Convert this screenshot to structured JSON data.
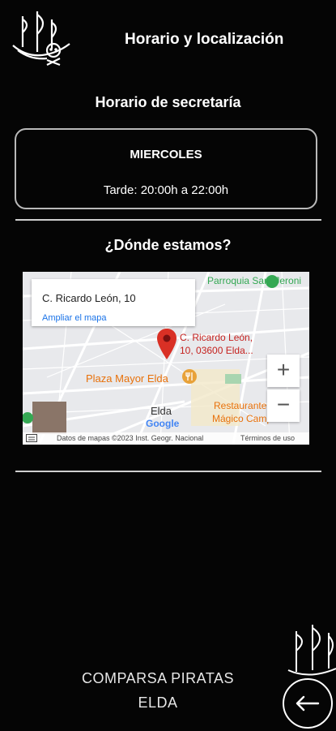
{
  "header": {
    "title": "Horario y localización",
    "logo_icon": "pirate-ship-skull-logo"
  },
  "schedule": {
    "title": "Horario de secretaría",
    "day": "MIERCOLES",
    "hours": "Tarde: 20:00h a 22:00h"
  },
  "location": {
    "title": "¿Dónde estamos?",
    "map": {
      "info_address": "C. Ricardo León, 10",
      "info_link": "Ampliar el mapa",
      "pin_label_line1": "C. Ricardo León,",
      "pin_label_line2": "10, 03600 Elda...",
      "place_parish": "Parroquia Sant Jeroni",
      "place_plaza": "Plaza Mayor Elda",
      "place_town": "Elda",
      "place_restaurant_line1": "Restaurante",
      "place_restaurant_line2": "Mágico Campi",
      "google_logo": "Google",
      "zoom_in": "+",
      "zoom_out": "−",
      "attribution": "Datos de mapas ©2023 Inst. Geogr. Nacional",
      "terms": "Términos de uso"
    }
  },
  "footer": {
    "line1": "COMPARSA PIRATAS",
    "line2": "ELDA",
    "back_icon": "arrow-left-icon"
  },
  "colors": {
    "background": "#050505",
    "text": "#ffffff",
    "card_border": "#b9b9b9",
    "map_pin": "#d93025",
    "map_link": "#1a73e8",
    "place_orange": "#e8710a"
  }
}
